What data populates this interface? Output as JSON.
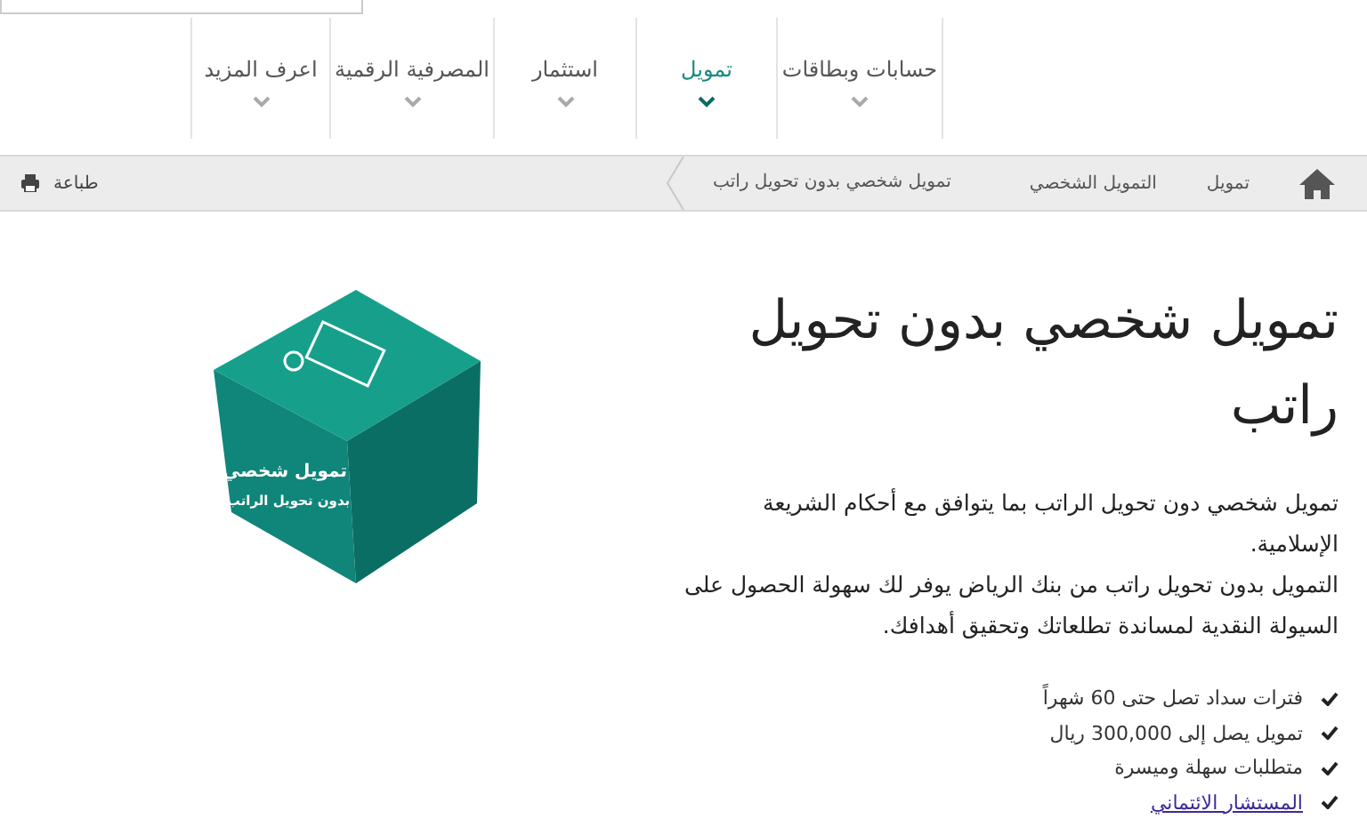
{
  "nav": {
    "items": [
      {
        "label": "حسابات وبطاقات",
        "selected": false
      },
      {
        "label": "تمويل",
        "selected": true
      },
      {
        "label": "استثمار",
        "selected": false
      },
      {
        "label": "المصرفية الرقمية",
        "selected": false
      },
      {
        "label": "اعرف المزيد",
        "selected": false
      }
    ]
  },
  "breadcrumb": {
    "items": [
      {
        "label": "تمويل",
        "current": false
      },
      {
        "label": "التمويل الشخصي",
        "current": false
      },
      {
        "label": "تمويل شخصي بدون تحويل راتب",
        "current": true
      }
    ],
    "print": "طباعة"
  },
  "hero": {
    "title": "تمويل شخصي بدون تحويل راتب",
    "paragraphs": [
      "تمويل شخصي دون تحويل الراتب بما يتوافق مع أحكام الشريعة الإسلامية.",
      "التمويل بدون تحويل راتب من بنك الرياض يوفر لك سهولة الحصول على السيولة النقدية لمساندة تطلعاتك وتحقيق أهدافك."
    ],
    "features": [
      {
        "text": "فترات سداد تصل حتى 60 شهراً",
        "kind": "text"
      },
      {
        "text": "تمويل يصل إلى 300,000 ريال",
        "kind": "text"
      },
      {
        "text": "متطلبات سهلة وميسرة",
        "kind": "text"
      },
      {
        "text": "المستشار الائتماني",
        "kind": "link"
      }
    ],
    "illustration": {
      "lines": [
        "تمويل شخصي",
        "بدون تحويل الراتب"
      ]
    }
  }
}
